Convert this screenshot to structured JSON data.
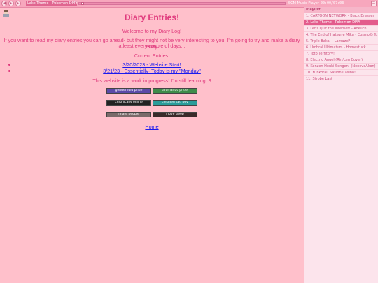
{
  "player": {
    "track_title": "Lake Theme - Pokemon DPPt",
    "name": "SCM Music Player",
    "time": "00:00/07:03",
    "progress": 0.01
  },
  "page": {
    "title": "Diary Entries!",
    "welcome": "Welcome to my Diary Log!",
    "intro_line1": "If you want to read my diary entries you can go ahead- but they might not be very interesting to you! I'm going to try and make a diary entry",
    "intro_line2": "atleast every couple of days...",
    "entries_heading": "Current Entries:",
    "entries": [
      "3/20/2023 - Website Start!",
      "3/21/23 - Essentially- Today is my \"Monday\""
    ],
    "wip": "This website is a work in progress! I'm still learning :3",
    "home": "Home"
  },
  "badges": [
    {
      "label": "genderfluid pride",
      "color": "#5b4aa8"
    },
    {
      "label": "aromantic pride",
      "color": "#3e8c4a"
    },
    {
      "label": "chronically online",
      "color": "#222222"
    },
    {
      "label": "certified sad boy",
      "color": "#2a9c9a"
    },
    {
      "label": "i hate people",
      "color": "#7a6a6a"
    },
    {
      "label": "i love sleep",
      "color": "#3a2a2a"
    }
  ],
  "playlist": {
    "header": "Playlist",
    "items": [
      "1. CARTOON NETWORK - Black Dresses",
      "2. Lake Theme - Pokemon DPPt",
      "3. Let's Quit the Internet! - Aokuchi",
      "4. The End of Hatsune Miku - Cosmo@ ft. Hatsune Miku",
      "5. Triple Baka! - LamazeP",
      "6. Umbral Ultimatum - Homestuck",
      "7. Toto Territory!",
      "8. Electric Angel (Rin/Len Cover)",
      "9. Kenzen Houki Sengen! (NeoevoAkon)",
      "10. Funkotau Sasihn Casino!",
      "11. Strobe Last"
    ],
    "active_index": 1
  }
}
